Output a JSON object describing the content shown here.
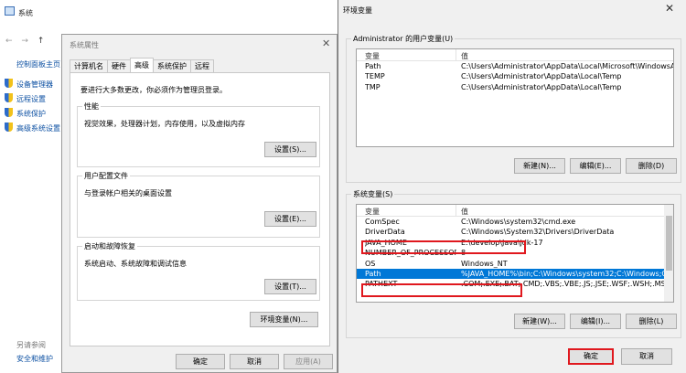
{
  "background_window": {
    "title": "系统",
    "nav": [
      "←",
      "→",
      "↑"
    ],
    "sidebar": {
      "home": "控制面板主页",
      "items": [
        "设备管理器",
        "远程设置",
        "系统保护",
        "高级系统设置"
      ],
      "see_also": "另请参阅",
      "security": "安全和维护"
    }
  },
  "system_properties": {
    "title": "系统属性",
    "close": "✕",
    "tabs": [
      "计算机名",
      "硬件",
      "高级",
      "系统保护",
      "远程"
    ],
    "active_tab": "高级",
    "admin_note": "要进行大多数更改，你必须作为管理员登录。",
    "groups": [
      {
        "label": "性能",
        "desc": "视觉效果，处理器计划，内存使用，以及虚拟内存",
        "button": "设置(S)..."
      },
      {
        "label": "用户配置文件",
        "desc": "与登录帐户相关的桌面设置",
        "button": "设置(E)..."
      },
      {
        "label": "启动和故障恢复",
        "desc": "系统启动、系统故障和调试信息",
        "button": "设置(T)..."
      }
    ],
    "env_button": "环境变量(N)...",
    "ok": "确定",
    "cancel": "取消",
    "apply": "应用(A)"
  },
  "env_vars": {
    "title": "环境变量",
    "close": "✕",
    "user_section": {
      "label": "Administrator 的用户变量(U)",
      "col_var": "变量",
      "col_val": "值",
      "rows": [
        {
          "name": "Path",
          "value": "C:\\Users\\Administrator\\AppData\\Local\\Microsoft\\WindowsA..."
        },
        {
          "name": "TEMP",
          "value": "C:\\Users\\Administrator\\AppData\\Local\\Temp"
        },
        {
          "name": "TMP",
          "value": "C:\\Users\\Administrator\\AppData\\Local\\Temp"
        }
      ],
      "buttons": [
        "新建(N)...",
        "编辑(E)...",
        "删除(D)"
      ]
    },
    "system_section": {
      "label": "系统变量(S)",
      "col_var": "变量",
      "col_val": "值",
      "rows": [
        {
          "name": "ComSpec",
          "value": "C:\\Windows\\system32\\cmd.exe"
        },
        {
          "name": "DriverData",
          "value": "C:\\Windows\\System32\\Drivers\\DriverData"
        },
        {
          "name": "JAVA_HOME",
          "value": "E:\\develop\\Java\\jdk-17"
        },
        {
          "name": "NUMBER_OF_PROCESSORS",
          "value": "8"
        },
        {
          "name": "OS",
          "value": "Windows_NT"
        },
        {
          "name": "Path",
          "value": "%JAVA_HOME%\\bin;C:\\Windows\\system32;C:\\Windows;C:\\Wi..."
        },
        {
          "name": "PATHEXT",
          "value": ".COM;.EXE;.BAT;.CMD;.VBS;.VBE;.JS;.JSE;.WSF;.WSH;.MSC"
        }
      ],
      "selected_row": "Path",
      "buttons": [
        "新建(W)...",
        "编辑(I)...",
        "删除(L)"
      ]
    },
    "ok": "确定",
    "cancel": "取消",
    "highlight_color": "#e0181e",
    "selection_color": "#0078d7"
  }
}
